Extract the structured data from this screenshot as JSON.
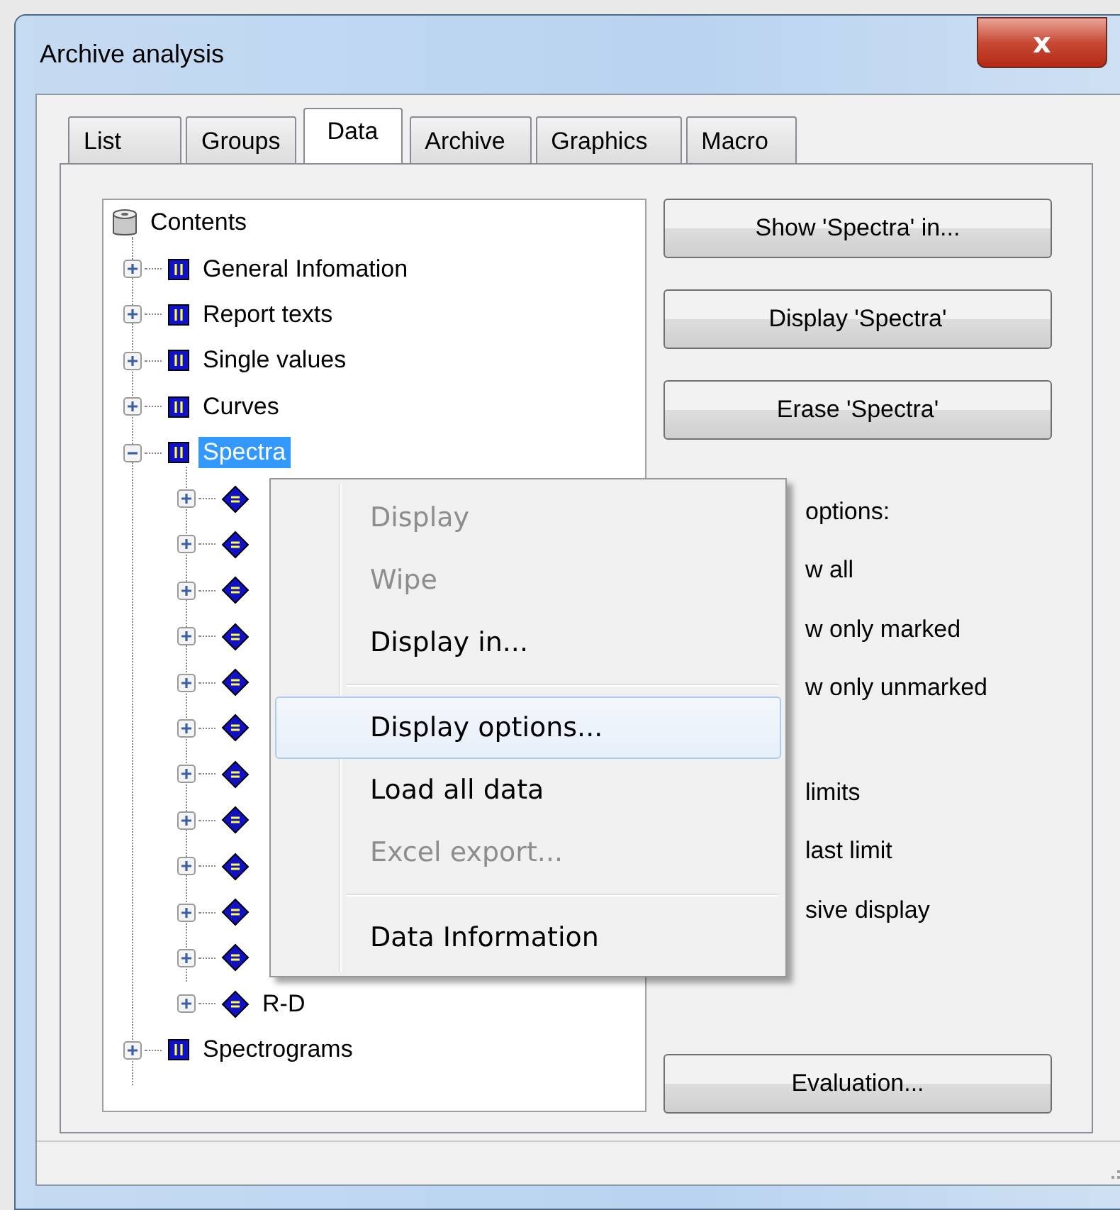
{
  "window": {
    "title": "Archive analysis",
    "close": "x"
  },
  "tabs": [
    {
      "label": "List",
      "selected": false
    },
    {
      "label": "Groups",
      "selected": false
    },
    {
      "label": "Data",
      "selected": true
    },
    {
      "label": "Archive",
      "selected": false
    },
    {
      "label": "Graphics",
      "selected": false
    },
    {
      "label": "Macro",
      "selected": false
    }
  ],
  "tree": {
    "root": "Contents",
    "items": [
      {
        "label": "General Infomation",
        "expanded": false,
        "selected": false
      },
      {
        "label": "Report texts",
        "expanded": false,
        "selected": false
      },
      {
        "label": "Single values",
        "expanded": false,
        "selected": false
      },
      {
        "label": "Curves",
        "expanded": false,
        "selected": false
      },
      {
        "label": "Spectra",
        "expanded": true,
        "selected": true,
        "children": [
          {
            "expanded": false
          },
          {
            "expanded": false
          },
          {
            "expanded": false
          },
          {
            "expanded": false
          },
          {
            "expanded": false
          },
          {
            "expanded": false
          },
          {
            "expanded": false
          },
          {
            "expanded": false
          },
          {
            "expanded": false
          },
          {
            "expanded": false
          },
          {
            "expanded": false
          },
          {
            "label": "R-D",
            "expanded": false
          }
        ]
      },
      {
        "label": "Spectrograms",
        "expanded": false,
        "selected": false
      }
    ]
  },
  "side_panel": {
    "buttons": [
      "Show 'Spectra' in...",
      "Display 'Spectra'",
      "Erase 'Spectra'"
    ],
    "text_groups": [
      [
        "options:",
        "w all",
        "w only marked",
        "w only unmarked"
      ],
      [
        "limits",
        "last limit",
        "sive display"
      ]
    ],
    "bottom_button": "Evaluation..."
  },
  "context_menu": [
    {
      "kind": "item",
      "label": "Display",
      "disabled": true,
      "selected": false
    },
    {
      "kind": "item",
      "label": "Wipe",
      "disabled": true,
      "selected": false
    },
    {
      "kind": "item",
      "label": "Display in...",
      "disabled": false,
      "selected": false
    },
    {
      "kind": "separator"
    },
    {
      "kind": "item",
      "label": "Display options...",
      "disabled": false,
      "selected": true
    },
    {
      "kind": "item",
      "label": "Load all data",
      "disabled": false,
      "selected": false
    },
    {
      "kind": "item",
      "label": "Excel export...",
      "disabled": true,
      "selected": false
    },
    {
      "kind": "separator"
    },
    {
      "kind": "item",
      "label": "Data Information",
      "disabled": false,
      "selected": false
    }
  ]
}
